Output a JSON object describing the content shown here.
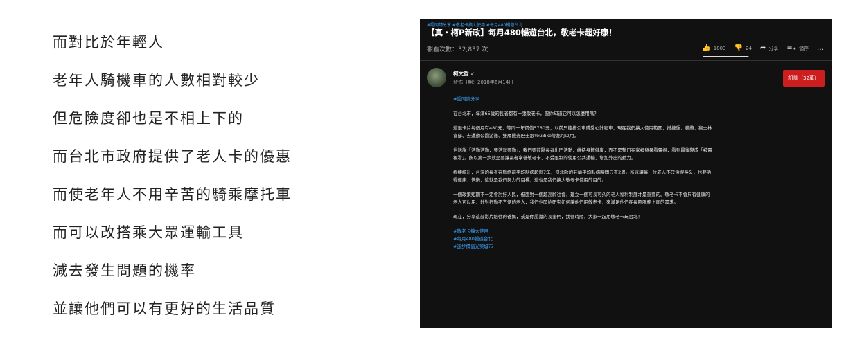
{
  "left_text": [
    "而對比於年輕人",
    "老年人騎機車的人數相對較少",
    "但危險度卻也是不相上下的",
    "而台北市政府提供了老人卡的優惠",
    "而使老年人不用辛苦的騎乘摩托車",
    "而可以改搭乘大眾運輸工具",
    "減去發生問題的機率",
    "並讓他們可以有更好的生活品質"
  ],
  "video": {
    "tags": "#認同請分享 #敬老卡擴大使用 #每月480暢遊台北",
    "title": "【真・柯P新政】每月480暢遊台北，敬老卡超好康！",
    "views": "觀看次數：32,837 次",
    "likes": "1803",
    "dislikes": "24",
    "like_ratio": 0.987,
    "share_label": "分享",
    "save_label": "儲存",
    "more_label": "…",
    "channel": "柯文哲",
    "pub_date": "發佈日期：2018年6月14日",
    "subscribe": "訂閱（32萬）",
    "hashtag_top": "#認同請分享",
    "paragraphs": [
      "在台北市，年滿65歲的長者都有一張敬老卡，但你知道它可以怎麼用嗎？",
      "這張卡片每個月有480元，等同一年價值5760元，以前只能搭公車或愛心計程車，現在我們擴大使用範圍，搭捷運、貓纜、猴士林官邸、去運動公園游泳、雙層觀光巴士跟YouBike等都可以用。",
      "俗話說「活動活動，要活就要動」，我們要鼓勵長者出門活動，維持身體健康，而不是整日在家裡發呆看電視，看到最後變成「被電視看」。所以第一步就是要讓長者拿著敬老卡，不受限制的使用公共運輸，增加外出的動力。",
      "根據統計，台灣的長者在臨終前平均臥病超過7年，但北歐的芬蘭平均臥病時間只有2周。所以讓每一位老人不只活得長久，也要活得健康、快樂，這就是我們努力的目標，這也是我們擴大敬老卡使用的目的。",
      "一個政策短期不一定會討好人民，但面對一個超高齡社會，建立一個可長可久的老人福利制度才是重要的。敬老卡不會只有健康的老人可以用，針對行動不方便的老人，我們也開始研究如何讓他們用敬老卡，來滿足他們在長照服務上面的需求。",
      "現在，分享這部影片給你的爸媽，或是你認識的長輩們，找個時間，大家一起用敬老卡玩台北！"
    ],
    "hashtags_bottom": [
      "#敬老卡擴大使用",
      "#每月480暢遊台北",
      "#進步價值光榮城市"
    ]
  }
}
